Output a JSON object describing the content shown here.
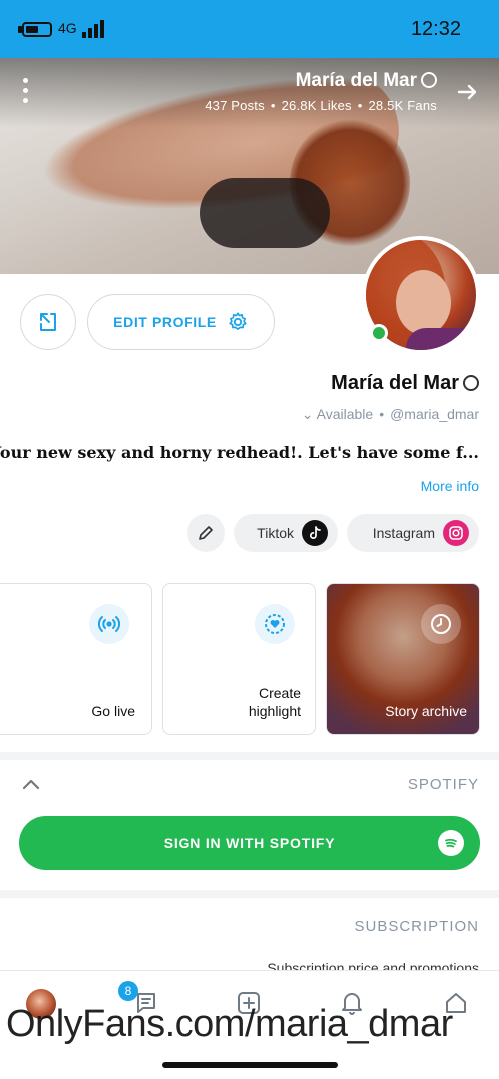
{
  "status_bar": {
    "time": "12:32",
    "network": "4G"
  },
  "cover": {
    "name": "María del Mar",
    "stats": {
      "posts": "437 Posts",
      "likes": "26.8K Likes",
      "fans": "28.5K Fans"
    }
  },
  "actions": {
    "edit_profile": "EDIT PROFILE"
  },
  "profile": {
    "name": "María del Mar",
    "handle": "@maria_dmar",
    "availability": "Available",
    "bio": "Your new sexy and horny redhead!. Let's have some f...",
    "more_info": "More info"
  },
  "social_links": [
    {
      "label": "Instagram"
    },
    {
      "label": "Tiktok"
    }
  ],
  "highlights": [
    {
      "label": "Story archive"
    },
    {
      "label_line1": "Create",
      "label_line2": "highlight"
    },
    {
      "label": "Go live"
    }
  ],
  "spotify": {
    "title": "SPOTIFY",
    "button": "SIGN IN WITH SPOTIFY"
  },
  "subscription": {
    "title": "SUBSCRIPTION",
    "description": "Subscription price and promotions"
  },
  "bottom_nav": {
    "badge": "8"
  },
  "watermark": "OnlyFans.com/maria_dmar",
  "colors": {
    "accent": "#1aa3e8",
    "spotify_green": "#22b852",
    "instagram_pink": "#e4267a",
    "online": "#2bb24c"
  }
}
